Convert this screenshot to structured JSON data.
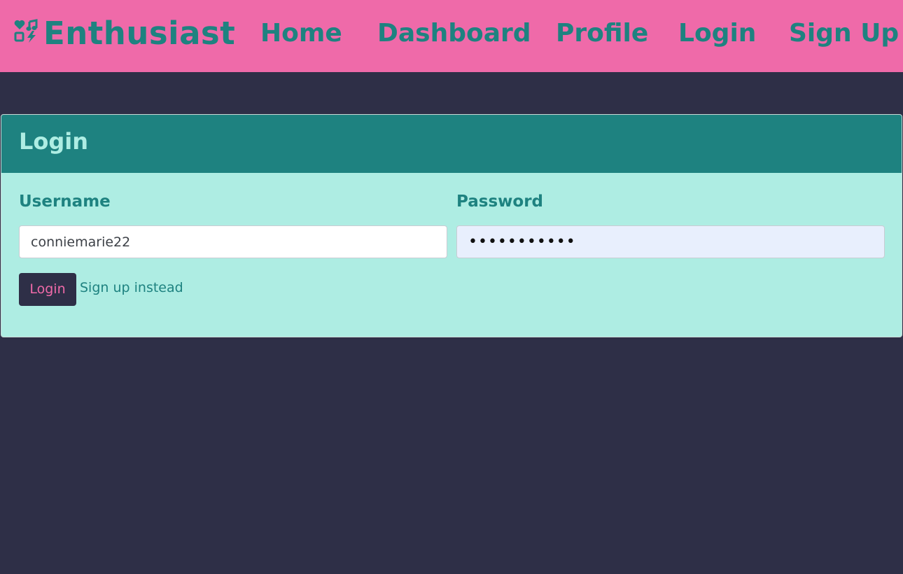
{
  "colors": {
    "navbar_bg": "#ef6aa9",
    "page_bg": "#2e2f47",
    "accent_teal": "#1e8280",
    "card_body_bg": "#aeede3",
    "button_bg": "#2e2f47",
    "button_text": "#ef6aa9"
  },
  "navbar": {
    "brand": {
      "icon": "hobbies-icon",
      "label": "Enthusiast"
    },
    "links": {
      "home": "Home",
      "dashboard": "Dashboard",
      "profile": "Profile",
      "login": "Login",
      "signup": "Sign Up"
    }
  },
  "login_card": {
    "title": "Login",
    "username": {
      "label": "Username",
      "value": "conniemarie22"
    },
    "password": {
      "label": "Password",
      "value": "•••••••••••"
    },
    "submit_label": "Login",
    "signup_link_label": "Sign up instead"
  }
}
